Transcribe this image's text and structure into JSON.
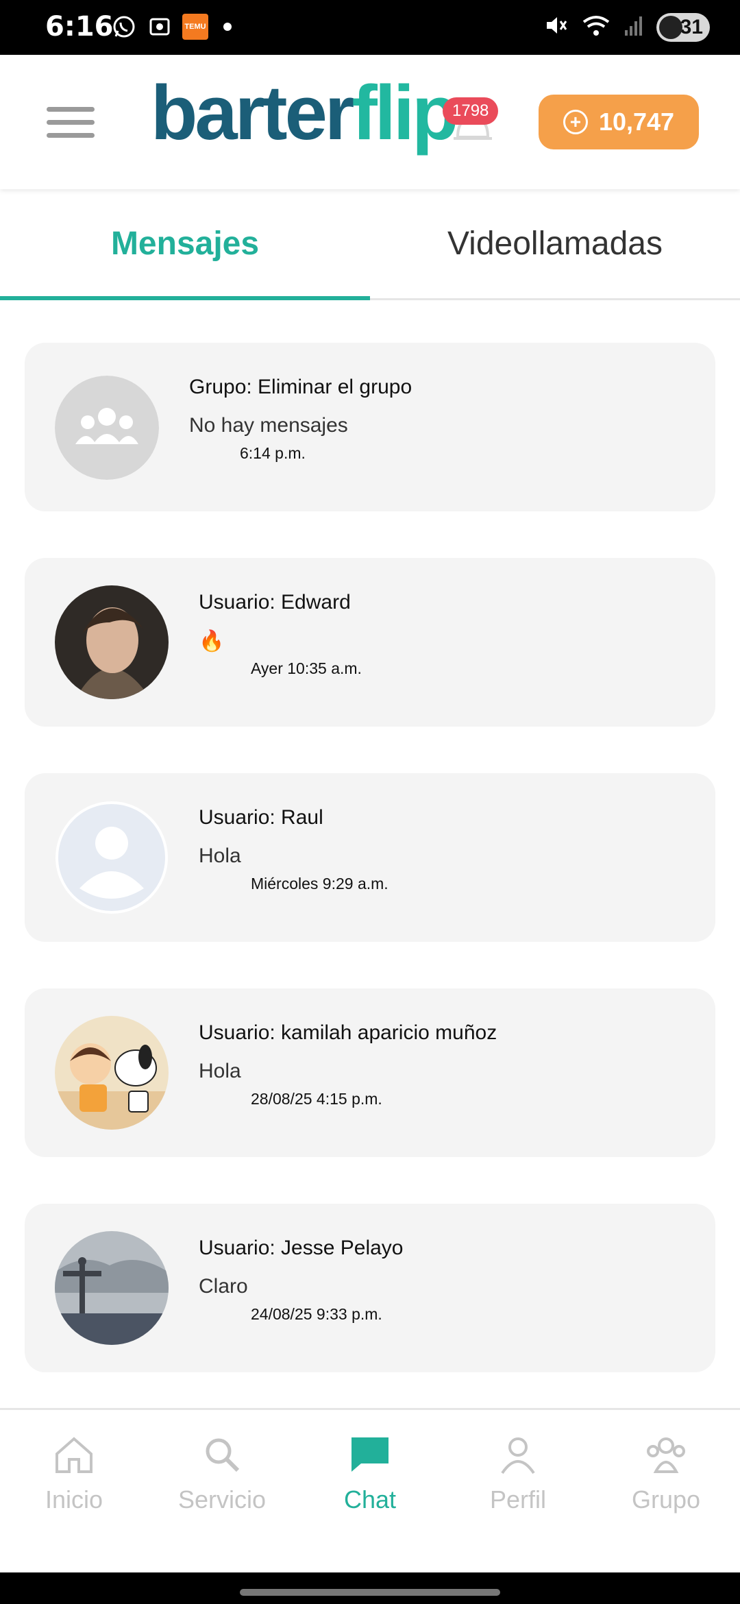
{
  "status_bar": {
    "time": "6:16",
    "battery_level": "31",
    "temu_label": "TEMU"
  },
  "header": {
    "logo_part1": "barter",
    "logo_part2": "flip",
    "notification_count": "1798",
    "coins": "10,747"
  },
  "tabs": [
    {
      "label": "Mensajes",
      "active": true
    },
    {
      "label": "Videollamadas",
      "active": false
    }
  ],
  "chats": [
    {
      "title": "Grupo: Eliminar el grupo",
      "message": "No hay mensajes",
      "time": "6:14 p.m.",
      "avatar": "group-placeholder"
    },
    {
      "title": "Usuario: Edward",
      "message": "🔥",
      "time": "Ayer 10:35 a.m.",
      "avatar": "photo-edward"
    },
    {
      "title": "Usuario: Raul",
      "message": "Hola",
      "time": "Miércoles 9:29 a.m.",
      "avatar": "user-placeholder"
    },
    {
      "title": "Usuario: kamilah aparicio muñoz",
      "message": "Hola",
      "time": "28/08/25 4:15 p.m.",
      "avatar": "cartoon-snoopy"
    },
    {
      "title": "Usuario: Jesse Pelayo",
      "message": "Claro",
      "time": "24/08/25 9:33 p.m.",
      "avatar": "photo-statue"
    }
  ],
  "bottom_nav": [
    {
      "label": "Inicio",
      "icon": "home-icon",
      "active": false
    },
    {
      "label": "Servicio",
      "icon": "search-icon",
      "active": false
    },
    {
      "label": "Chat",
      "icon": "chat-icon",
      "active": true
    },
    {
      "label": "Perfil",
      "icon": "profile-icon",
      "active": false
    },
    {
      "label": "Grupo",
      "icon": "group-icon",
      "active": false
    }
  ],
  "colors": {
    "accent": "#22b09a",
    "brand_dark": "#1b5e78",
    "coins_bg": "#f5a04a",
    "badge": "#ea4b5a"
  }
}
